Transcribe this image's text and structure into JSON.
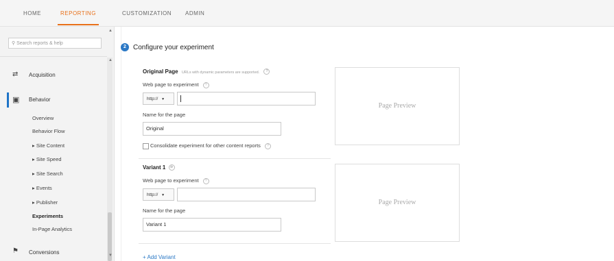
{
  "topnav": {
    "tabs": [
      {
        "label": "HOME"
      },
      {
        "label": "REPORTING"
      },
      {
        "label": "CUSTOMIZATION"
      },
      {
        "label": "ADMIN"
      }
    ],
    "active_tab": "REPORTING"
  },
  "sidebar": {
    "search_placeholder": "Search reports & help",
    "acquisition": {
      "label": "Acquisition",
      "icon": "acquisition-icon"
    },
    "behavior": {
      "label": "Behavior",
      "icon": "behavior-icon"
    },
    "behavior_items": [
      {
        "label": "Overview"
      },
      {
        "label": "Behavior Flow"
      },
      {
        "label": "▸ Site Content"
      },
      {
        "label": "▸ Site Speed"
      },
      {
        "label": "▸ Site Search"
      },
      {
        "label": "▸ Events"
      },
      {
        "label": "▸ Publisher"
      },
      {
        "label": "Experiments"
      },
      {
        "label": "In-Page Analytics"
      }
    ],
    "conversions": {
      "label": "Conversions",
      "icon": "flag-icon"
    }
  },
  "main": {
    "step_number": "2",
    "section_title": "Configure your experiment",
    "original": {
      "heading": "Original Page",
      "note": "URLs with dynamic parameters are supported.",
      "web_page_label": "Web page to experiment",
      "protocol": "http://",
      "url_value": "",
      "name_label": "Name for the page",
      "name_value": "Original",
      "consolidate_label": "Consolidate experiment for other content reports",
      "consolidate_checked": false
    },
    "variant": {
      "heading": "Variant 1",
      "web_page_label": "Web page to experiment",
      "protocol": "http://",
      "url_value": "",
      "name_label": "Name for the page",
      "name_value": "Variant 1"
    },
    "preview_label": "Page Preview",
    "add_variant_label": "+ Add Variant"
  }
}
